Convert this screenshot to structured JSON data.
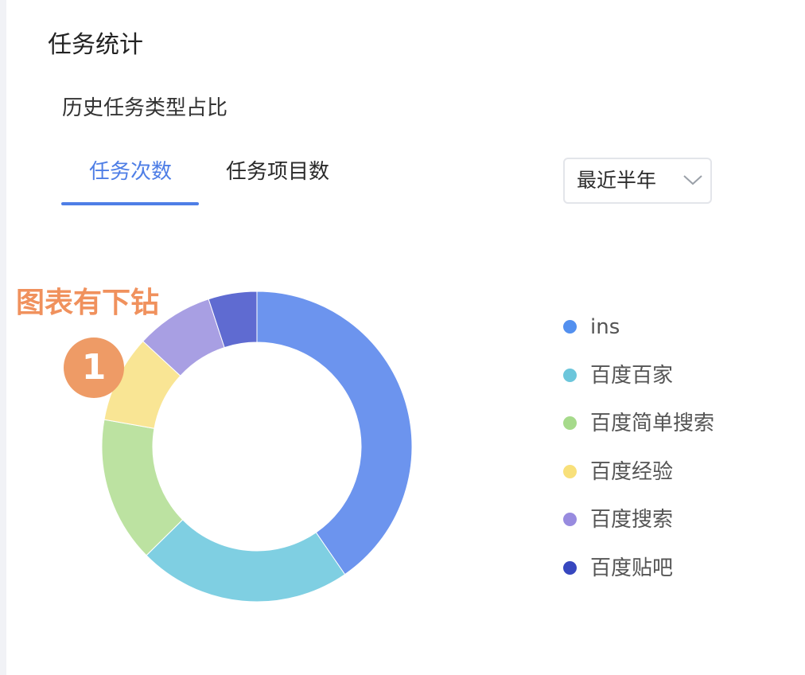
{
  "page": {
    "title": "任务统计",
    "section_title": "历史任务类型占比"
  },
  "tabs": [
    {
      "label": "任务次数",
      "active": true
    },
    {
      "label": "任务项目数",
      "active": false
    }
  ],
  "period_select": {
    "value": "最近半年"
  },
  "annotation": {
    "text": "图表有下钻",
    "badge": "1"
  },
  "chart_data": {
    "type": "pie",
    "donut": true,
    "categories": [
      "ins",
      "百度百家",
      "百度简单搜索",
      "百度经验",
      "百度搜索",
      "百度贴吧"
    ],
    "values": [
      40,
      22,
      15,
      9,
      8,
      5
    ],
    "colors": [
      "#6c94ee",
      "#7fcfe2",
      "#bce2a1",
      "#f9e594",
      "#a89fe3",
      "#5f6bd1"
    ],
    "legend_colors": [
      "#5390ef",
      "#6cc6db",
      "#a6da8b",
      "#f8e07a",
      "#988bdf",
      "#3747bf"
    ],
    "legend_position": "right"
  }
}
